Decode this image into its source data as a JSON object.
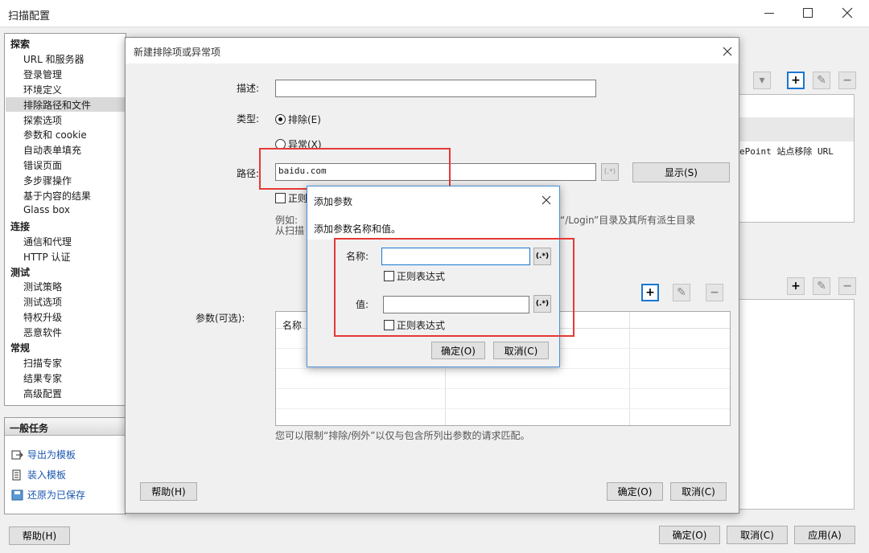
{
  "window": {
    "title": "扫描配置"
  },
  "tree": {
    "groups": [
      {
        "head": "探索",
        "items": [
          "URL 和服务器",
          "登录管理",
          "环境定义",
          "排除路径和文件",
          "探索选项",
          "参数和 cookie",
          "自动表单填充",
          "错误页面",
          "多步骤操作",
          "基于内容的结果",
          "Glass box"
        ]
      },
      {
        "head": "连接",
        "items": [
          "通信和代理",
          "HTTP 认证"
        ]
      },
      {
        "head": "测试",
        "items": [
          "测试策略",
          "测试选项",
          "特权升级",
          "恶意软件"
        ]
      },
      {
        "head": "常规",
        "items": [
          "扫描专家",
          "结果专家",
          "高级配置"
        ]
      }
    ],
    "selected": "排除路径和文件"
  },
  "tasks": {
    "title": "一般任务",
    "items": [
      {
        "label": "导出为模板"
      },
      {
        "label": "装入模板"
      },
      {
        "label": "还原为已保存"
      }
    ]
  },
  "main": {
    "help_button": "帮助(H)",
    "ok_button": "确定(O)",
    "cancel_button": "取消(C)",
    "apply_button": "应用(A)",
    "bg_list_text": "ePoint 站点移除 URL"
  },
  "dialog": {
    "title": "新建排除项或异常项",
    "desc_label": "描述:",
    "type_label": "类型:",
    "radio_exclude": "排除(E)",
    "radio_exception": "异常(X)",
    "path_label": "路径:",
    "path_value": "baidu.com",
    "regex_button": "(.*)",
    "show_button": "显示(S)",
    "regex_check": "正则",
    "example_line1_a": "例如:",
    "example_line1_b": "将“/Login”目录及其所有派生目录",
    "example_line2": "从扫描",
    "params_label": "参数(可选):",
    "params_header": "名称",
    "note": "您可以限制“排除/例外”以仅与包含所列出参数的请求匹配。",
    "help_button": "帮助(H)",
    "ok_button": "确定(O)",
    "cancel_button": "取消(C)"
  },
  "param_dialog": {
    "title": "添加参数",
    "prompt": "添加参数名称和值。",
    "name_label": "名称:",
    "name_value": "",
    "value_label": "值:",
    "value_value": "",
    "regex_button": "(.*)",
    "regex_check": "正则表达式",
    "ok_button": "确定(O)",
    "cancel_button": "取消(C)"
  },
  "colors": {
    "highlight": "#e53935",
    "accent": "#1976d2"
  }
}
